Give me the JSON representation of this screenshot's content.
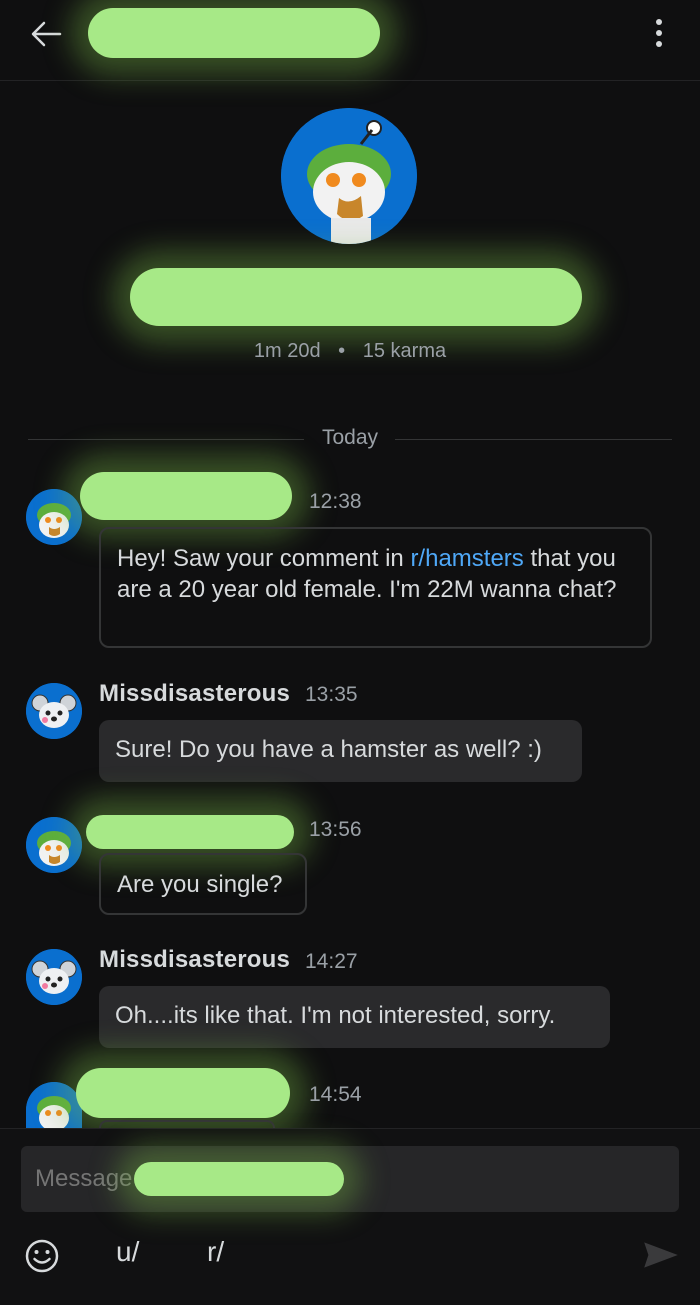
{
  "header": {
    "back_icon": "back-arrow-icon",
    "menu_icon": "more-vertical-icon"
  },
  "profile": {
    "avatar_icon": "snoo-avatar-icon",
    "account_age": "1m 20d",
    "separator": "•",
    "karma": "15 karma"
  },
  "divider_label": "Today",
  "messages": [
    {
      "sender": "",
      "time": "12:38",
      "text_before": "Hey! Saw your comment in ",
      "link": "r/hamsters",
      "text_after": " that you are a 20 year old female. I'm 22M wanna chat?"
    },
    {
      "sender": "Missdisasterous",
      "time": "13:35",
      "text": "Sure! Do you have a hamster as well? :)"
    },
    {
      "sender": "",
      "time": "13:56",
      "text": "Are you single?"
    },
    {
      "sender": "Missdisasterous",
      "time": "14:27",
      "text": "Oh....its like that. I'm not interested, sorry."
    },
    {
      "sender": "",
      "time": "14:54",
      "text": ""
    }
  ],
  "composer": {
    "placeholder": "Message",
    "emoji_icon": "emoji-icon",
    "user_button": "u/",
    "subreddit_button": "r/",
    "send_icon": "send-icon"
  },
  "colors": {
    "background": "#0f0f10",
    "accent_link": "#4fa8f7",
    "redaction": "#a7e987",
    "avatar_blue": "#0a6fcf"
  }
}
